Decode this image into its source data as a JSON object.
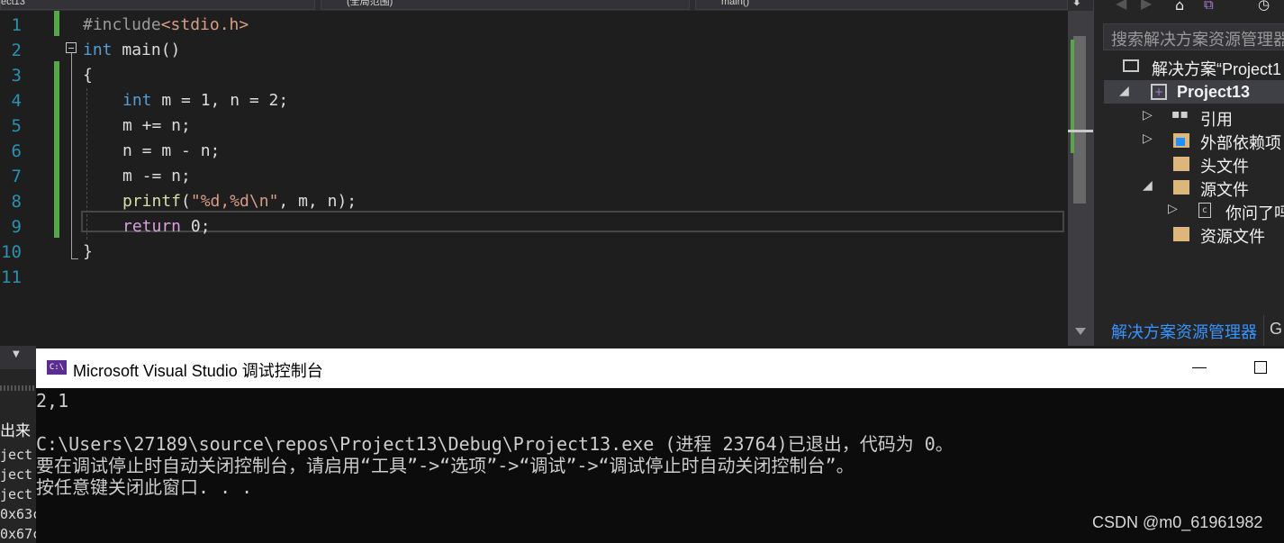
{
  "nav_bar": {
    "project_label": "ect13",
    "scope_label": "(全局范围)",
    "member_label": "main()"
  },
  "editor": {
    "line_numbers": [
      "1",
      "2",
      "3",
      "4",
      "5",
      "6",
      "7",
      "8",
      "9",
      "10",
      "11"
    ],
    "code": {
      "l1_directive": "#include",
      "l1_header": "<stdio.h>",
      "l2_type": "int",
      "l2_rest": " main()",
      "l3": "{",
      "l4_type": "int",
      "l4_rest": " m = 1, n = 2;",
      "l5": "m += n;",
      "l6": "n = m - n;",
      "l7": "m -= n;",
      "l8_fn": "printf",
      "l8_open": "(",
      "l8_str": "\"%d,%d\\n\"",
      "l8_rest": ", m, n);",
      "l9_kw": "return",
      "l9_rest": " 0;",
      "l10": "}"
    }
  },
  "solution_explorer": {
    "search_placeholder": "搜索解决方案资源管理器",
    "solution_label": "解决方案“Project1",
    "project_name": "Project13",
    "references": "引用",
    "external_deps": "外部依赖项",
    "header_files": "头文件",
    "source_files": "源文件",
    "source_file_item": "你问了吗",
    "resource_files": "资源文件",
    "tab_active": "解决方案资源管理器",
    "tab_next": "G"
  },
  "left_panel": {
    "header": "出来",
    "lines": [
      "ject",
      "ject",
      "ject",
      "0x63c",
      "0x67c"
    ]
  },
  "console": {
    "title": "Microsoft Visual Studio 调试控制台",
    "icon_text": "C:\\",
    "output_lines": [
      "2,1",
      "",
      "C:\\Users\\27189\\source\\repos\\Project13\\Debug\\Project13.exe (进程 23764)已退出，代码为 0。",
      "要在调试停止时自动关闭控制台，请启用“工具”->“选项”->“调试”->“调试停止时自动关闭控制台”。",
      "按任意键关闭此窗口. . ."
    ],
    "watermark": "CSDN @m0_61961982"
  }
}
